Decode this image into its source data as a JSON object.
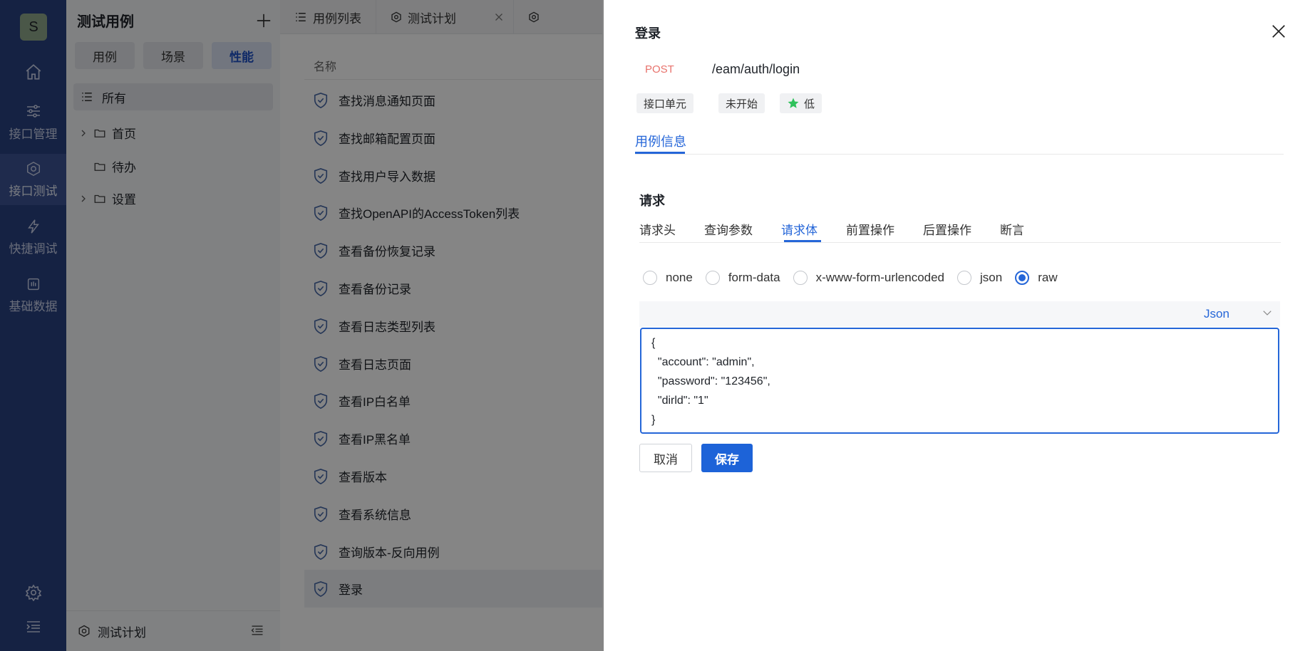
{
  "nav": {
    "avatar": "S",
    "items": [
      {
        "label": "接口管理",
        "icon": "sliders-icon"
      },
      {
        "label": "接口测试",
        "icon": "hexagon-icon"
      },
      {
        "label": "快捷调试",
        "icon": "lightning-icon"
      },
      {
        "label": "基础数据",
        "icon": "database-icon"
      }
    ]
  },
  "tree": {
    "title": "测试用例",
    "tabs": [
      "用例",
      "场景",
      "性能"
    ],
    "all_label": "所有",
    "nodes": [
      "首页",
      "待办",
      "设置"
    ],
    "footer_label": "测试计划"
  },
  "tabs": [
    {
      "label": "用例列表"
    },
    {
      "label": "测试计划"
    }
  ],
  "list": {
    "column_header": "名称",
    "rows": [
      "查找消息通知页面",
      "查找邮箱配置页面",
      "查找用户导入数据",
      "查找OpenAPI的AccessToken列表",
      "查看备份恢复记录",
      "查看备份记录",
      "查看日志类型列表",
      "查看日志页面",
      "查看IP白名单",
      "查看IP黑名单",
      "查看版本",
      "查看系统信息",
      "查询版本-反向用例",
      "登录"
    ]
  },
  "drawer": {
    "title": "登录",
    "method": "POST",
    "path": "/eam/auth/login",
    "tags": [
      "接口单元",
      "未开始",
      "低"
    ],
    "tab": "用例信息",
    "section_title": "请求",
    "request_tabs": [
      "请求头",
      "查询参数",
      "请求体",
      "前置操作",
      "后置操作",
      "断言"
    ],
    "body_types": [
      "none",
      "form-data",
      "x-www-form-urlencoded",
      "json",
      "raw"
    ],
    "body_type_selected": "raw",
    "language": "Json",
    "body": "{\n  \"account\": \"admin\",\n  \"password\": \"123456\",\n  \"dirld\": \"1\"\n}",
    "cancel_label": "取消",
    "save_label": "保存"
  },
  "colors": {
    "nav_bg": "#2a4181",
    "accent": "#2566d8",
    "method": "#e8726c",
    "priority_star": "#2fc25b"
  }
}
